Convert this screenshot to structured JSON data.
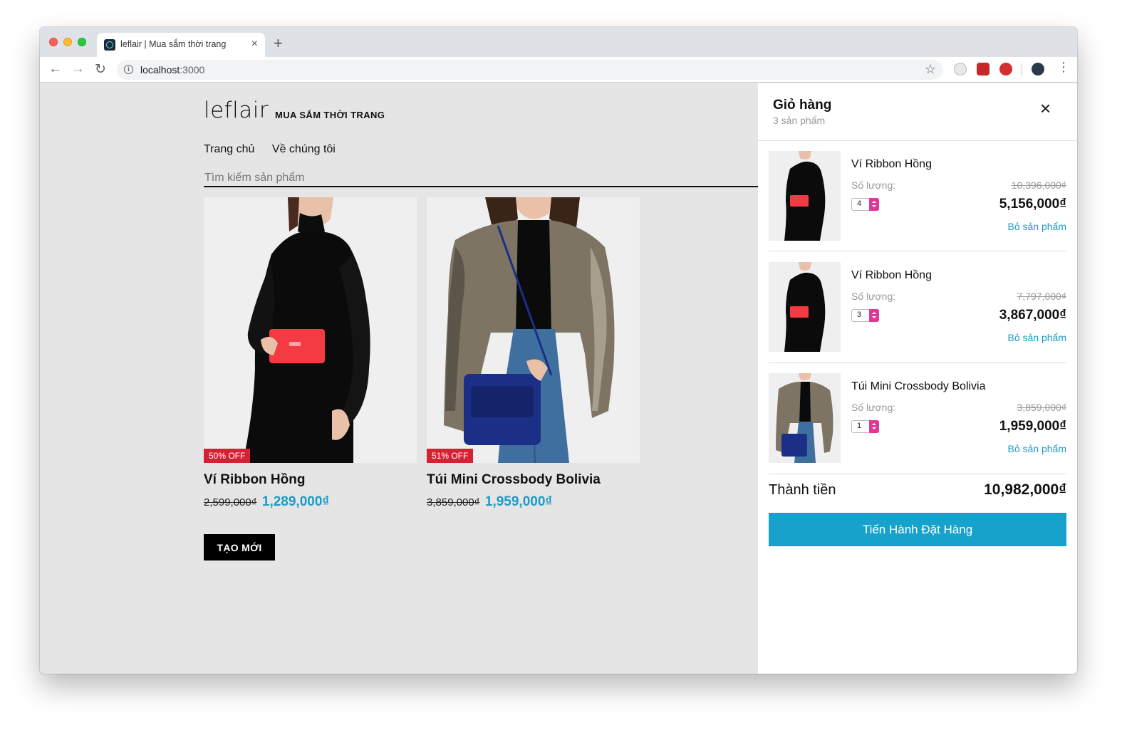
{
  "browser": {
    "tab_title": "leflair | Mua sắm thời trang",
    "tab_close": "×",
    "new_tab": "+",
    "url_host": "localhost",
    "url_port": ":3000"
  },
  "store": {
    "brand": "leflair",
    "tagline": "MUA SẮM THỜI TRANG",
    "nav": [
      "Trang chủ",
      "Về chúng tôi"
    ],
    "search_placeholder": "Tìm kiếm sản phẩm",
    "create_button": "TẠO MỚI"
  },
  "products": [
    {
      "name": "Ví Ribbon Hồng",
      "badge": "50% OFF",
      "old_price": "2,599,000₫",
      "price": "1,289,000₫",
      "bag_color": "#f23b43"
    },
    {
      "name": "Túi Mini Crossbody Bolivia",
      "badge": "51% OFF",
      "old_price": "3,859,000₫",
      "price": "1,959,000₫",
      "bag_color": "#1c2f86"
    }
  ],
  "cart": {
    "title": "Giỏ hàng",
    "count_text": "3 sản phẩm",
    "close": "×",
    "qty_label": "Số lượng:",
    "remove_label": "Bỏ sản phẩm",
    "items": [
      {
        "name": "Ví Ribbon Hồng",
        "qty": "4",
        "orig": "10,396,000₫",
        "price": "5,156,000₫"
      },
      {
        "name": "Ví Ribbon Hồng",
        "qty": "3",
        "orig": "7,797,000₫",
        "price": "3,867,000₫"
      },
      {
        "name": "Túi Mini Crossbody Bolivia",
        "qty": "1",
        "orig": "3,859,000₫",
        "price": "1,959,000₫"
      }
    ],
    "total_label": "Thành tiền",
    "total_value": "10,982,000₫",
    "checkout_label": "Tiến Hành Đặt Hàng"
  },
  "colors": {
    "accent_blue": "#17a2cc",
    "price_blue": "#1b9cc6",
    "badge_red": "#d32233",
    "spinner_pink": "#e03894"
  }
}
